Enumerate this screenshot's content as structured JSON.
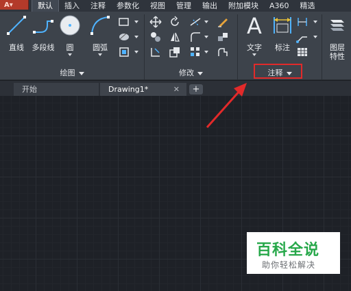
{
  "tabs": [
    "默认",
    "插入",
    "注释",
    "参数化",
    "视图",
    "管理",
    "输出",
    "附加模块",
    "A360",
    "精选"
  ],
  "active_tab_index": 0,
  "ribbon": {
    "draw_tools": [
      {
        "label": "直线",
        "icon": "line-icon"
      },
      {
        "label": "多段线",
        "icon": "polyline-icon"
      },
      {
        "label": "圆",
        "icon": "circle-icon"
      },
      {
        "label": "圆弧",
        "icon": "arc-icon"
      }
    ],
    "annot_tools": [
      {
        "label": "文字",
        "icon": "text-icon"
      },
      {
        "label": "标注",
        "icon": "dimension-icon"
      }
    ],
    "layer_tool": {
      "label": "图层",
      "label2": "特性",
      "icon": "layer-properties-icon"
    },
    "panels": {
      "draw": "绘图",
      "modify": "修改",
      "annotation": "注释"
    }
  },
  "doc_tabs": [
    "开始",
    "Drawing1*"
  ],
  "watermark": {
    "title": "百科全说",
    "subtitle": "助你轻松解决"
  },
  "colors": {
    "accent_red": "#e22a2a",
    "watermark_green": "#27a84a",
    "ribbon": "#3d434b",
    "canvas": "#1e2127"
  }
}
